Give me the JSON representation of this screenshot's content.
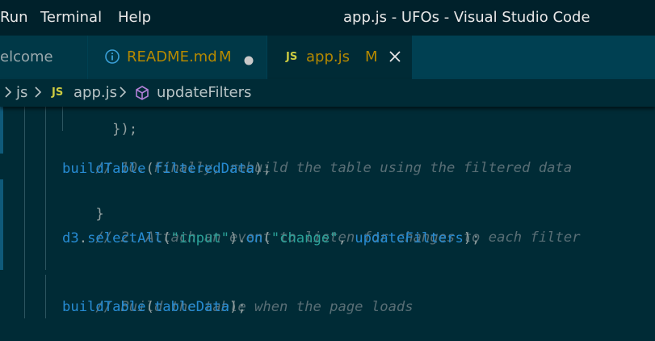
{
  "titlebar": {
    "menu": [
      "Run",
      "Terminal",
      "Help"
    ],
    "window_title": "app.js - UFOs - Visual Studio Code"
  },
  "tabs": [
    {
      "label": "elcome",
      "icon": "vscode-welcome",
      "active": false
    },
    {
      "label": "README.md",
      "badge": "M",
      "icon": "info-icon",
      "dirty": true,
      "active": false
    },
    {
      "label": "app.js",
      "badge": "M",
      "icon": "js-file-icon",
      "icon_text": "JS",
      "active": true
    }
  ],
  "breadcrumb": {
    "folder": "js",
    "file": "app.js",
    "file_icon_text": "JS",
    "symbol": "updateFilters"
  },
  "code": {
    "line_partial": "  });",
    "line_comment_10": "// 10. Finally, rebuild the table using the filtered data",
    "line_build_fn": "buildTable",
    "line_build_arg": "filteredData",
    "line_close": "}",
    "line_comment_2": "// 2. Attach an event to listen for changes to each filter",
    "line_d3_obj": "d3",
    "line_d3_select": "selectAll",
    "line_d3_input": "\"input\"",
    "line_d3_on": "on",
    "line_d3_change": "\"change\"",
    "line_d3_handler": "updateFilters",
    "line_comment_build": "// Build the table when the page loads",
    "line_build2_fn": "buildTable",
    "line_build2_arg": "tableData"
  },
  "colors": {
    "editor_bg": "#002b36",
    "comment": "#586e75",
    "function": "#268bd2",
    "string": "#2aa198",
    "js_icon": "#cbcb41",
    "modified": "#b58900"
  }
}
